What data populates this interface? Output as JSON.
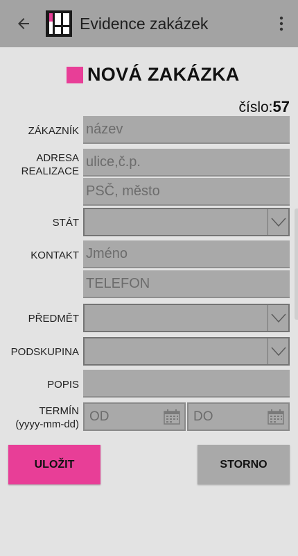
{
  "appbar": {
    "title": "Evidence zakázek",
    "back_icon": "arrow-left-icon",
    "more_icon": "vertical-dots-icon"
  },
  "heading": {
    "title": "NOVÁ ZAKÁZKA",
    "number_label": "číslo:",
    "number_value": "57"
  },
  "form": {
    "customer": {
      "label": "ZÁKAZNÍK",
      "placeholder": "název"
    },
    "address": {
      "label_line1": "ADRESA",
      "label_line2": "REALIZACE",
      "street_placeholder": "ulice,č.p.",
      "city_placeholder": "PSČ, město"
    },
    "country": {
      "label": "STÁT",
      "value": ""
    },
    "contact": {
      "label": "KONTAKT",
      "name_placeholder": "Jméno",
      "phone_placeholder": "TELEFON"
    },
    "subject": {
      "label": "PŘEDMĚT",
      "value": ""
    },
    "subgroup": {
      "label": "PODSKUPINA",
      "value": ""
    },
    "description": {
      "label": "POPIS",
      "placeholder": ""
    },
    "term": {
      "label_line1": "TERMÍN",
      "label_line2": "(yyyy-mm-dd)",
      "from_placeholder": "OD",
      "to_placeholder": "DO"
    }
  },
  "buttons": {
    "save": "ULOŽIT",
    "cancel": "STORNO"
  },
  "colors": {
    "accent": "#e83e97",
    "appbar": "#a3a3a3",
    "background": "#e3e3e3",
    "field": "#a9a9a9"
  }
}
